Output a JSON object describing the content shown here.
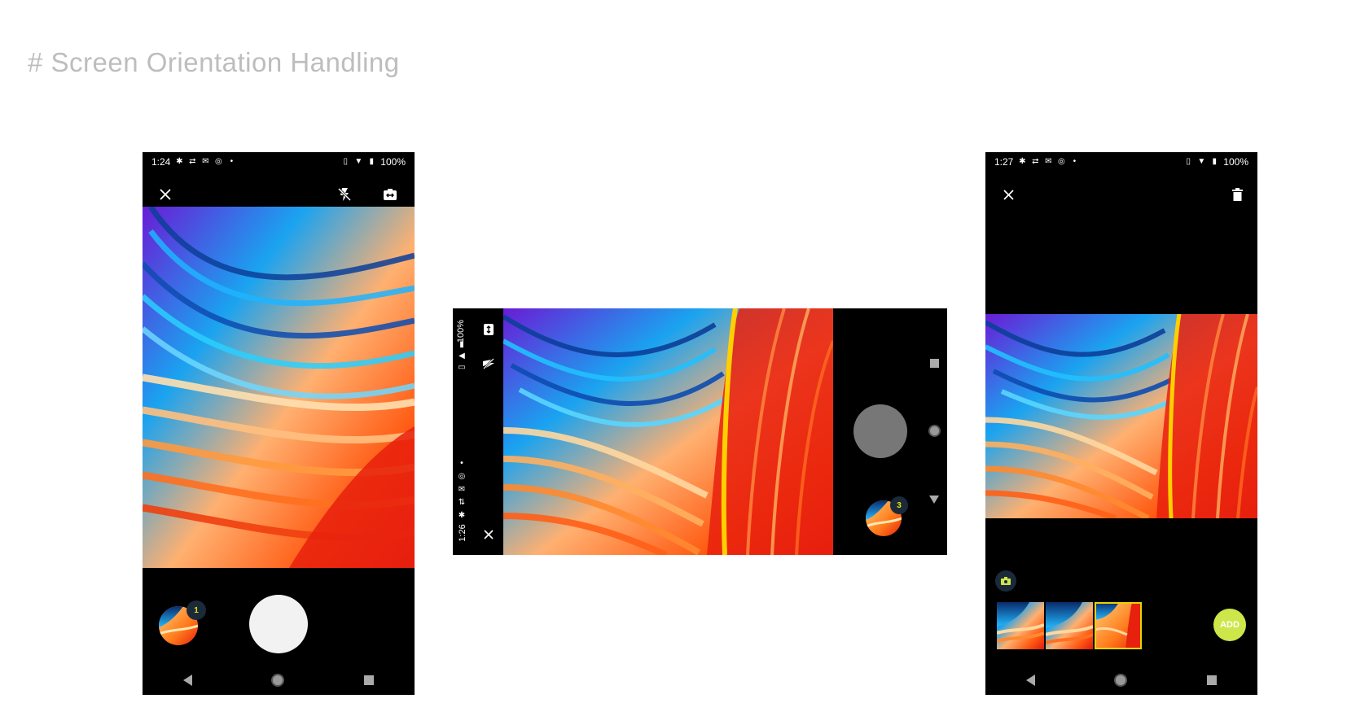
{
  "page": {
    "heading": "# Screen Orientation Handling"
  },
  "phone_portrait": {
    "status": {
      "time": "1:24",
      "battery": "100%"
    },
    "toolbar": {
      "close_icon": "close-icon",
      "flash_icon": "flash-off-icon",
      "switch_camera_icon": "switch-camera-icon"
    },
    "thumbnail_badge": "1"
  },
  "phone_landscape": {
    "status": {
      "time": "1:26",
      "battery": "100%"
    },
    "thumbnail_badge": "3"
  },
  "phone_review": {
    "status": {
      "time": "1:27",
      "battery": "100%"
    },
    "add_label": "ADD"
  },
  "colors": {
    "accent": "#cde64a",
    "badge_bg": "#1b2a3a",
    "badge_text": "#e6e600",
    "selected_border": "#e8d400"
  }
}
